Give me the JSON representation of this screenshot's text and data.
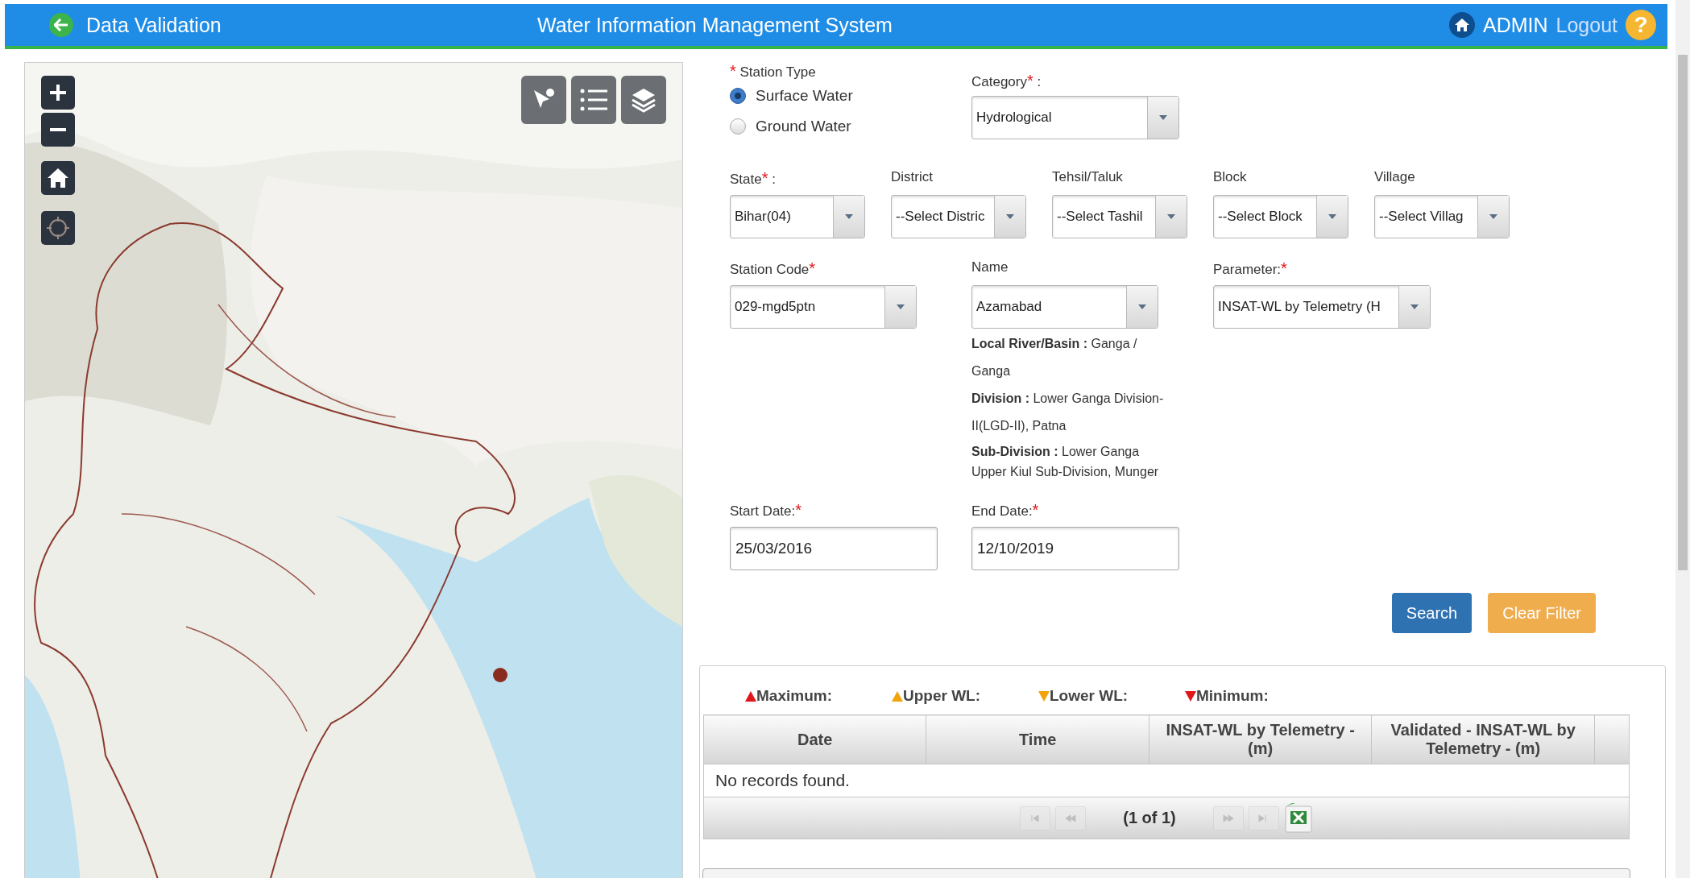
{
  "header": {
    "title": "Data Validation",
    "app_title": "Water Information Management System",
    "user": "ADMIN",
    "logout": "Logout",
    "help": "?"
  },
  "station_type": {
    "label": "Station Type",
    "mark": "*",
    "options": [
      {
        "label": "Surface Water",
        "selected": true
      },
      {
        "label": "Ground Water",
        "selected": false
      }
    ]
  },
  "category": {
    "label": "Category",
    "mark": "*",
    "suffix": " :",
    "value": "Hydrological"
  },
  "location_fields": [
    {
      "label": "State",
      "mark": "*",
      "suffix": " :",
      "value": "Bihar(04)"
    },
    {
      "label": "District",
      "value": "--Select Distric"
    },
    {
      "label": "Tehsil/Taluk",
      "value": "--Select Tashil"
    },
    {
      "label": "Block",
      "value": "--Select Block"
    },
    {
      "label": "Village",
      "value": "--Select Villag"
    }
  ],
  "station_fields": [
    {
      "label": "Station Code",
      "mark": "*",
      "value": "029-mgd5ptn"
    },
    {
      "label": "Name",
      "value": "Azamabad"
    },
    {
      "label": "Parameter:",
      "mark": "*",
      "value": "INSAT-WL by Telemetry (H"
    }
  ],
  "station_info": [
    "**Local River/Basin :** Ganga / Ganga",
    "**Division :** Lower Ganga Division-II(LGD-II), Patna",
    "**Sub-Division :** Lower Ganga Upper Kiul Sub-Division, Munger"
  ],
  "date_fields": [
    {
      "label": "Start Date:",
      "mark": "*",
      "value": "25/03/2016"
    },
    {
      "label": "End Date:",
      "mark": "*",
      "value": "12/10/2019"
    }
  ],
  "buttons": [
    {
      "label": "Search",
      "kind": "primary"
    },
    {
      "label": "Clear Filter",
      "kind": "warning"
    }
  ],
  "legend": [
    {
      "label": "Maximum:",
      "kind": "up",
      "color": "#e0161b"
    },
    {
      "label": "Upper WL:",
      "kind": "up",
      "color": "#f0a30a"
    },
    {
      "label": "Lower WL:",
      "kind": "down",
      "color": "#f0a30a"
    },
    {
      "label": "Minimum:",
      "kind": "down",
      "color": "#e0161b"
    }
  ],
  "table": {
    "columns": [
      "Date",
      "Time",
      "INSAT-WL by Telemetry - (m)",
      "Validated - INSAT-WL by Telemetry - (m)"
    ],
    "empty_message": "No records found.",
    "paginator": {
      "page_report": "(1 of 1)",
      "buttons": [
        {
          "kind": "first",
          "disabled": true
        },
        {
          "kind": "prev",
          "disabled": true
        },
        {
          "kind": "next",
          "disabled": true
        },
        {
          "kind": "last",
          "disabled": true
        }
      ]
    }
  }
}
